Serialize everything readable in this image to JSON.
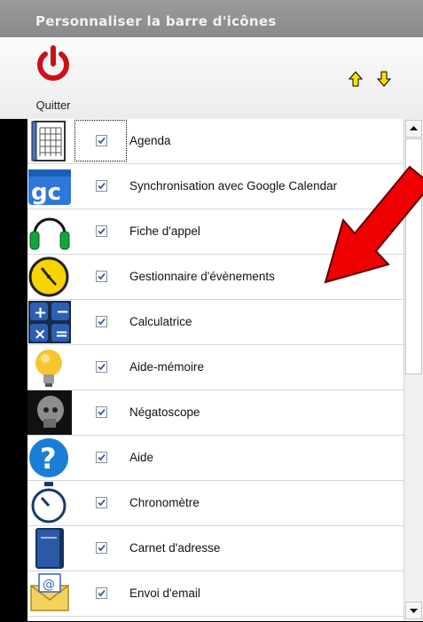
{
  "window": {
    "title": "Personnaliser la barre d'icônes"
  },
  "toolbar": {
    "quit_label": "Quitter",
    "move_up_icon": "arrow-up-icon",
    "move_down_icon": "arrow-down-icon",
    "arrow_color": "#f7e300"
  },
  "colors": {
    "power_red": "#cc1016",
    "annotation_red": "#ee0000",
    "check_blue": "#3a5ba0"
  },
  "items": [
    {
      "label": "Agenda",
      "checked": true,
      "icon": "agenda-icon"
    },
    {
      "label": "Synchronisation avec Google Calendar",
      "checked": true,
      "icon": "google-calendar-icon"
    },
    {
      "label": "Fiche d'appel",
      "checked": true,
      "icon": "headset-icon"
    },
    {
      "label": "Gestionnaire d'évènements",
      "checked": true,
      "icon": "clock-icon"
    },
    {
      "label": "Calculatrice",
      "checked": true,
      "icon": "calculator-icon"
    },
    {
      "label": "Aide-mémoire",
      "checked": true,
      "icon": "lightbulb-icon"
    },
    {
      "label": "Négatoscope",
      "checked": true,
      "icon": "xray-icon"
    },
    {
      "label": "Aide",
      "checked": true,
      "icon": "help-icon"
    },
    {
      "label": "Chronomètre",
      "checked": true,
      "icon": "stopwatch-icon"
    },
    {
      "label": "Carnet d'adresse",
      "checked": true,
      "icon": "address-book-icon"
    },
    {
      "label": "Envoi d'email",
      "checked": true,
      "icon": "email-icon"
    }
  ]
}
